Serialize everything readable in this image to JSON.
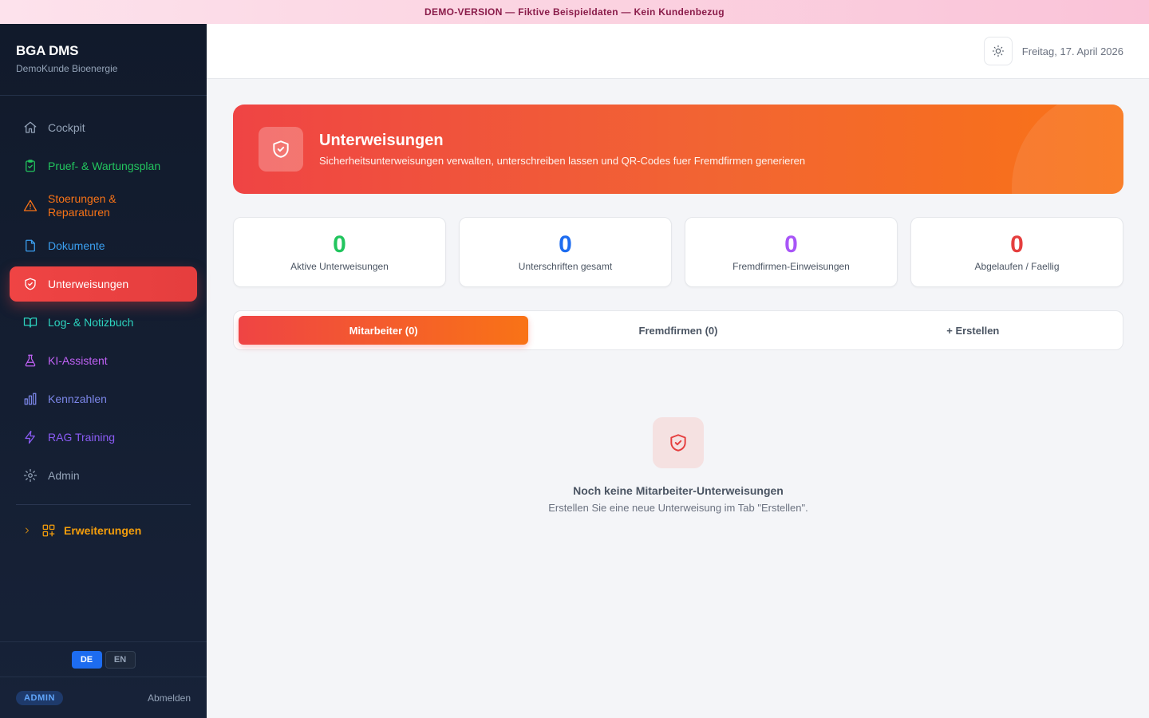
{
  "banner": {
    "text": "DEMO-VERSION — Fiktive Beispieldaten — Kein Kundenbezug"
  },
  "sidebar": {
    "brand": "BGA DMS",
    "subtitle": "DemoKunde Bioenergie",
    "items": [
      {
        "label": "Cockpit",
        "color": "#94a3b8",
        "icon": "home-icon"
      },
      {
        "label": "Pruef- & Wartungsplan",
        "color": "#22c55e",
        "icon": "clipboard-check-icon"
      },
      {
        "label": "Stoerungen & Reparaturen",
        "color": "#f97316",
        "icon": "warning-triangle-icon"
      },
      {
        "label": "Dokumente",
        "color": "#3b9ff0",
        "icon": "file-icon"
      },
      {
        "label": "Unterweisungen",
        "color": "#ffffff",
        "icon": "shield-check-icon",
        "active": true
      },
      {
        "label": "Log- & Notizbuch",
        "color": "#2dd4bf",
        "icon": "book-open-icon"
      },
      {
        "label": "KI-Assistent",
        "color": "#c061f5",
        "icon": "flask-icon"
      },
      {
        "label": "Kennzahlen",
        "color": "#7b86e8",
        "icon": "bar-chart-icon"
      },
      {
        "label": "RAG Training",
        "color": "#8b5cf6",
        "icon": "zap-icon"
      },
      {
        "label": "Admin",
        "color": "#94a3b8",
        "icon": "gear-icon"
      }
    ],
    "extensions_label": "Erweiterungen",
    "lang": {
      "de": "DE",
      "en": "EN"
    },
    "role_badge": "ADMIN",
    "logout": "Abmelden"
  },
  "topbar": {
    "date": "Freitag, 17. April 2026"
  },
  "hero": {
    "title": "Unterweisungen",
    "subtitle": "Sicherheitsunterweisungen verwalten, unterschreiben lassen und QR-Codes fuer Fremdfirmen generieren"
  },
  "stats": [
    {
      "value": "0",
      "label": "Aktive Unterweisungen",
      "color": "#22c55e"
    },
    {
      "value": "0",
      "label": "Unterschriften gesamt",
      "color": "#1d6cf0"
    },
    {
      "value": "0",
      "label": "Fremdfirmen-Einweisungen",
      "color": "#a855f7"
    },
    {
      "value": "0",
      "label": "Abgelaufen / Faellig",
      "color": "#e53e3e"
    }
  ],
  "tabs": [
    {
      "label": "Mitarbeiter (0)",
      "active": true
    },
    {
      "label": "Fremdfirmen (0)"
    },
    {
      "label": "+ Erstellen"
    }
  ],
  "empty": {
    "title": "Noch keine Mitarbeiter-Unterweisungen",
    "subtitle": "Erstellen Sie eine neue Unterweisung im Tab \"Erstellen\"."
  }
}
